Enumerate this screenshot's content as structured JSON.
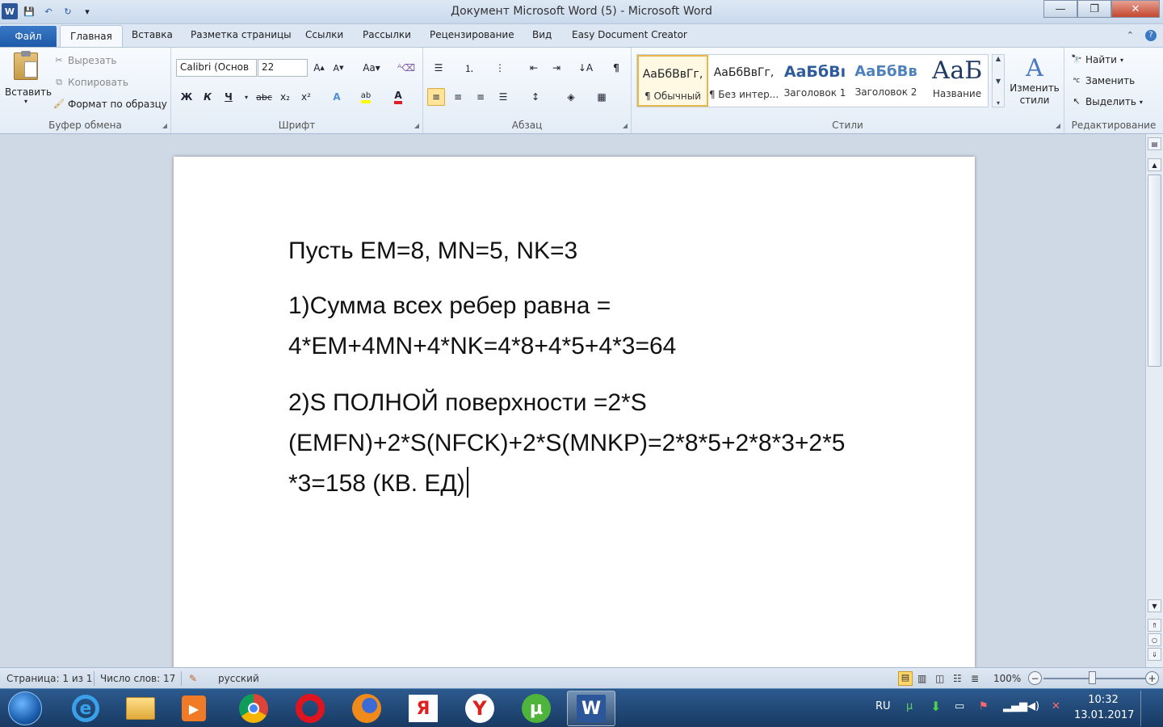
{
  "window": {
    "title": "Документ Microsoft Word (5)  -  Microsoft Word",
    "minimize": "—",
    "maximize": "❐",
    "close": "✕"
  },
  "ribbon_tabs": {
    "file": "Файл",
    "items": [
      "Главная",
      "Вставка",
      "Разметка страницы",
      "Ссылки",
      "Рассылки",
      "Рецензирование",
      "Вид",
      "Easy Document Creator"
    ],
    "active": "Главная"
  },
  "clipboard": {
    "paste": "Вставить",
    "cut": "Вырезать",
    "copy": "Копировать",
    "format_painter": "Формат по образцу",
    "label": "Буфер обмена"
  },
  "font": {
    "name": "Calibri (Основ",
    "size": "22",
    "bold": "Ж",
    "italic": "К",
    "underline": "Ч",
    "strike": "abc",
    "subscript": "x₂",
    "superscript": "x²",
    "change_case": "Aa",
    "label": "Шрифт"
  },
  "paragraph": {
    "label": "Абзац"
  },
  "styles": {
    "items": [
      {
        "preview": "АаБбВвГг,",
        "name": "¶ Обычный"
      },
      {
        "preview": "АаБбВвГг,",
        "name": "¶ Без интер..."
      },
      {
        "preview": "АаБбВı",
        "name": "Заголовок 1"
      },
      {
        "preview": "АаБбВв",
        "name": "Заголовок 2"
      },
      {
        "preview": "АаБ",
        "name": "Название"
      }
    ],
    "change_styles": "Изменить стили",
    "label": "Стили"
  },
  "editing": {
    "find": "Найти",
    "replace": "Заменить",
    "select": "Выделить",
    "label": "Редактирование"
  },
  "document": {
    "p1": "Пусть EM=8, MN=5, NK=3",
    "p2a": "1)Сумма всех ребер равна =",
    "p2b": "4*EM+4MN+4*NK=4*8+4*5+4*3=64",
    "p3a": "2)S ПОЛНОЙ поверхности =2*S",
    "p3b": "(EMFN)+2*S(NFCK)+2*S(MNKP)=2*8*5+2*8*3+2*5",
    "p3c": "*3=158 (КВ. ЕД)"
  },
  "status": {
    "page": "Страница: 1 из 1",
    "words": "Число слов: 17",
    "language": "русский",
    "zoom": "100%"
  },
  "taskbar": {
    "lang": "RU",
    "time": "10:32",
    "date": "13.01.2017"
  },
  "colors": {
    "accent": "#2b579a",
    "file_tab": "#1d5aa8",
    "taskbar": "#1e4672"
  }
}
